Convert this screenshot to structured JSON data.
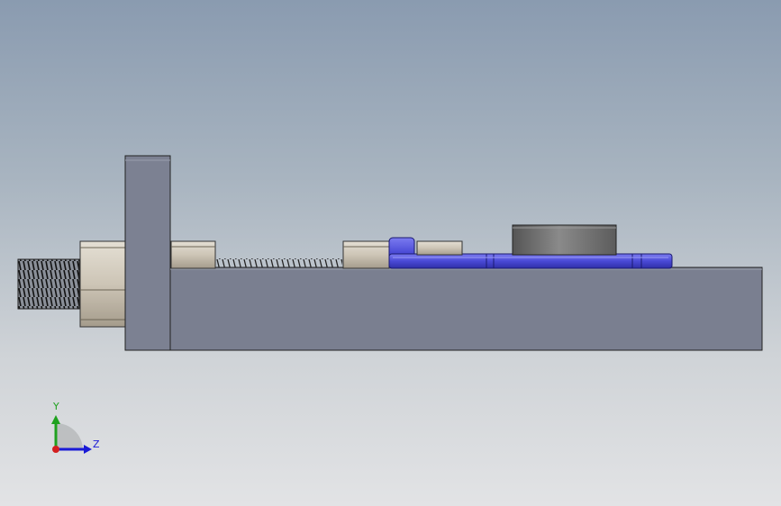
{
  "viewport": {
    "view": "side-view",
    "triad": {
      "y_label": "Y",
      "z_label": "Z",
      "y_color": "#1fa11f",
      "z_color": "#1a1ad6",
      "x_color": "#d31f1f"
    }
  },
  "colors": {
    "body_gray": "#7a7f90",
    "nut_tan": "#cdc5b6",
    "blue_part": "#4a4ad6",
    "cylinder": "#6f6f6f"
  }
}
